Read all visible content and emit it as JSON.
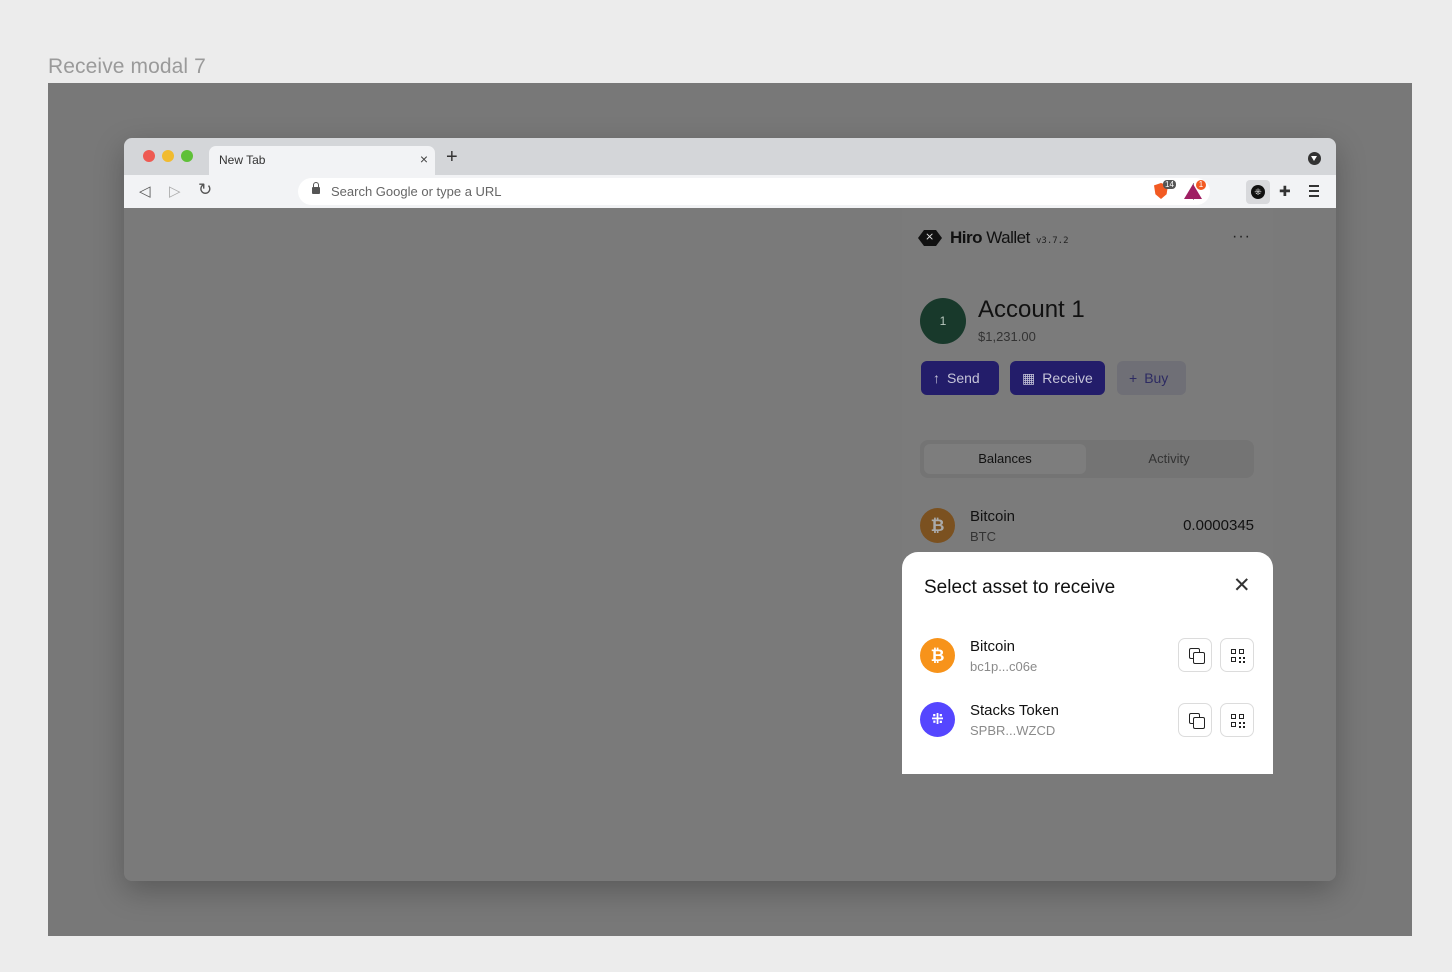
{
  "frame": {
    "title": "Receive modal 7"
  },
  "browser": {
    "tab": {
      "title": "New Tab",
      "close_glyph": "×",
      "new_tab_glyph": "+"
    },
    "toolbar": {
      "back_glyph": "◁",
      "forward_glyph": "▷",
      "reload_glyph": "↻",
      "omnibox_placeholder": "Search Google or type a URL",
      "extensions": {
        "brave_count": "14",
        "rewards_count": "1"
      }
    }
  },
  "wallet": {
    "brand_bold": "Hiro",
    "brand_rest": " Wallet",
    "version": "v3.7.2",
    "more_glyph": "···",
    "account": {
      "avatar_label": "1",
      "name": "Account 1",
      "balance": "$1,231.00"
    },
    "actions": {
      "send_icon": "↑",
      "send_label": "Send",
      "receive_label": "Receive",
      "buy_icon": "+",
      "buy_label": "Buy"
    },
    "tabs": {
      "balances": "Balances",
      "activity": "Activity"
    },
    "balances": [
      {
        "name": "Bitcoin",
        "symbol": "BTC",
        "amount": "0.0000345",
        "icon_glyph": "₿"
      }
    ]
  },
  "modal": {
    "title": "Select asset to receive",
    "close_glyph": "✕",
    "assets": [
      {
        "name": "Bitcoin",
        "address": "bc1p...c06e",
        "icon_glyph": "₿",
        "icon": "bitcoin-icon"
      },
      {
        "name": "Stacks Token",
        "address": "SPBR...WZCD",
        "icon_glyph": "⁜",
        "icon": "stacks-icon"
      }
    ]
  },
  "colors": {
    "accent": "#5546ff",
    "bitcoin": "#f7931a",
    "receive_button": "#231d6a",
    "overlay": "#7a7a7a"
  }
}
